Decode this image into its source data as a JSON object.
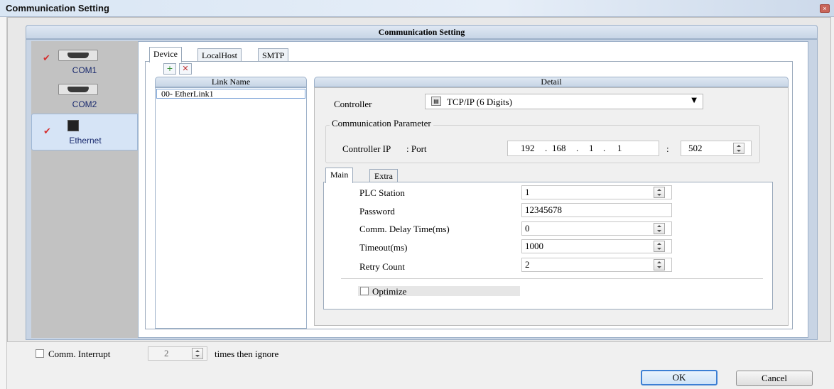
{
  "window": {
    "title": "Communication Setting",
    "close_glyph": "×"
  },
  "panel": {
    "title": "Communication Setting"
  },
  "sidebar": {
    "items": [
      {
        "label": "COM1",
        "checked": true,
        "icon": "serial-port-icon"
      },
      {
        "label": "COM2",
        "checked": false,
        "icon": "serial-port-icon"
      },
      {
        "label": "Ethernet",
        "checked": true,
        "selected": true,
        "icon": "ethernet-port-icon"
      }
    ],
    "check_glyph": "✔"
  },
  "tabs": [
    "Device",
    "LocalHost",
    "SMTP"
  ],
  "toolbar": {
    "add_glyph": "+",
    "delete_glyph": "✕"
  },
  "link_list": {
    "header": "Link Name",
    "rows": [
      "00- EtherLink1"
    ]
  },
  "detail": {
    "header": "Detail",
    "controller_label": "Controller",
    "controller_value": "TCP/IP (6 Digits)",
    "combo_arrow": "▼",
    "group_title": "Communication Parameter",
    "ip_label": "Controller IP",
    "port_label": ": Port",
    "ip": [
      "192",
      "168",
      "1",
      "1"
    ],
    "dot": ".",
    "colon": ":",
    "port": "502",
    "inner_tabs": [
      "Main",
      "Extra"
    ],
    "fields": [
      {
        "label": "PLC Station",
        "value": "1",
        "spin": true
      },
      {
        "label": "Password",
        "value": "12345678",
        "spin": false
      },
      {
        "label": "Comm. Delay Time(ms)",
        "value": "0",
        "spin": true
      },
      {
        "label": "Timeout(ms)",
        "value": "1000",
        "spin": true
      },
      {
        "label": "Retry Count",
        "value": "2",
        "spin": true
      }
    ],
    "optimize_label": "Optimize"
  },
  "footer": {
    "comm_interrupt_label": "Comm. Interrupt",
    "times_value": "2",
    "times_suffix": "times then ignore",
    "ok_label": "OK",
    "cancel_label": "Cancel"
  },
  "colors": {
    "accent": "#3c7fd4",
    "check": "#d53030",
    "selected_bg": "#d6e4f6"
  }
}
